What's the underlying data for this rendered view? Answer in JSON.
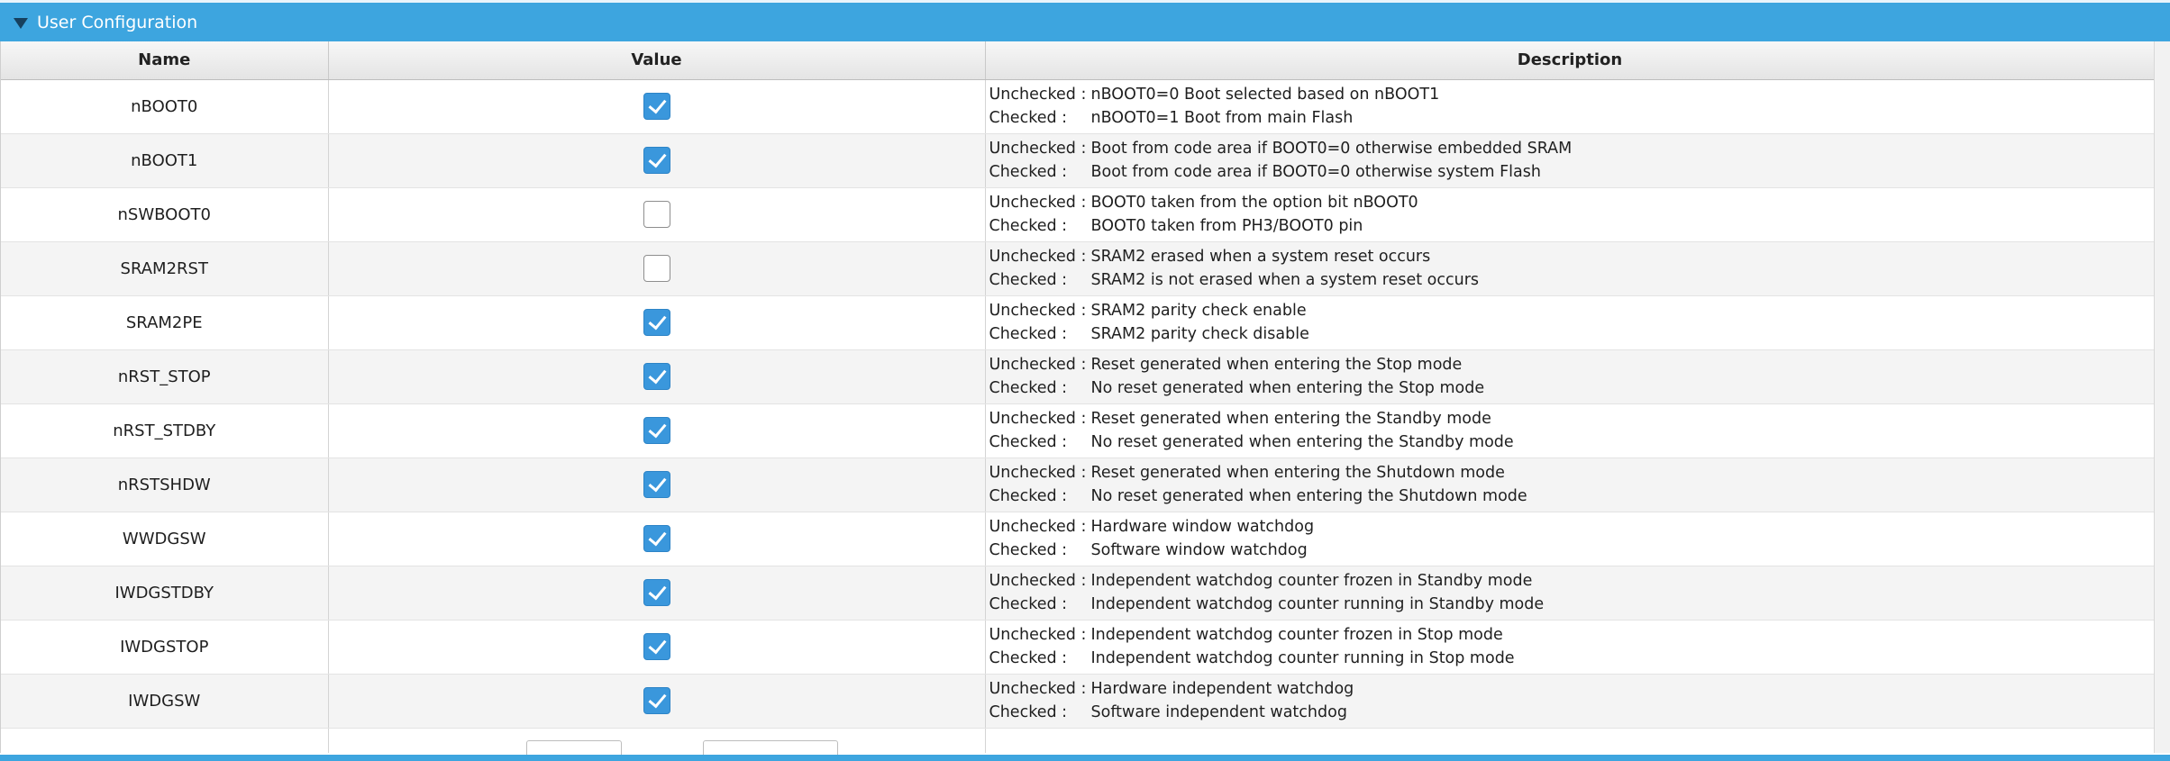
{
  "panel": {
    "title": "User Configuration"
  },
  "columns": {
    "name": "Name",
    "value": "Value",
    "description": "Description"
  },
  "rows": [
    {
      "name": "nBOOT0",
      "checked": true,
      "unchecked_label": "Unchecked",
      "unchecked_text": "nBOOT0=0 Boot selected based on nBOOT1",
      "checked_label": "Checked",
      "checked_text": "nBOOT0=1 Boot from main Flash"
    },
    {
      "name": "nBOOT1",
      "checked": true,
      "unchecked_label": "Unchecked",
      "unchecked_text": "Boot from code area if BOOT0=0 otherwise embedded SRAM",
      "checked_label": "Checked",
      "checked_text": "Boot from code area if BOOT0=0 otherwise system Flash"
    },
    {
      "name": "nSWBOOT0",
      "checked": false,
      "unchecked_label": "Unchecked",
      "unchecked_text": "BOOT0 taken from the option bit nBOOT0",
      "checked_label": "Checked",
      "checked_text": "BOOT0 taken from PH3/BOOT0 pin"
    },
    {
      "name": "SRAM2RST",
      "checked": false,
      "unchecked_label": "Unchecked",
      "unchecked_text": "SRAM2 erased when a system reset occurs",
      "checked_label": "Checked",
      "checked_text": "SRAM2 is not erased when a system reset occurs"
    },
    {
      "name": "SRAM2PE",
      "checked": true,
      "unchecked_label": "Unchecked",
      "unchecked_text": "SRAM2 parity check enable",
      "checked_label": "Checked",
      "checked_text": "SRAM2 parity check disable"
    },
    {
      "name": "nRST_STOP",
      "checked": true,
      "unchecked_label": "Unchecked",
      "unchecked_text": "Reset generated when entering the Stop mode",
      "checked_label": "Checked",
      "checked_text": "No reset generated when entering the Stop mode"
    },
    {
      "name": "nRST_STDBY",
      "checked": true,
      "unchecked_label": "Unchecked",
      "unchecked_text": "Reset generated when entering the Standby mode",
      "checked_label": "Checked",
      "checked_text": "No reset generated when entering the Standby mode"
    },
    {
      "name": "nRSTSHDW",
      "checked": true,
      "unchecked_label": "Unchecked",
      "unchecked_text": "Reset generated when entering the Shutdown mode",
      "checked_label": "Checked",
      "checked_text": "No reset generated when entering the Shutdown mode"
    },
    {
      "name": "WWDGSW",
      "checked": true,
      "unchecked_label": "Unchecked",
      "unchecked_text": "Hardware window watchdog",
      "checked_label": "Checked",
      "checked_text": "Software window watchdog"
    },
    {
      "name": "IWDGSTDBY",
      "checked": true,
      "unchecked_label": "Unchecked",
      "unchecked_text": "Independent watchdog counter frozen in Standby mode",
      "checked_label": "Checked",
      "checked_text": "Independent watchdog counter running in Standby mode"
    },
    {
      "name": "IWDGSTOP",
      "checked": true,
      "unchecked_label": "Unchecked",
      "unchecked_text": "Independent watchdog counter frozen in Stop mode",
      "checked_label": "Checked",
      "checked_text": "Independent watchdog counter running in Stop mode"
    },
    {
      "name": "IWDGSW",
      "checked": true,
      "unchecked_label": "Unchecked",
      "unchecked_text": "Hardware independent watchdog",
      "checked_label": "Checked",
      "checked_text": "Software independent watchdog"
    }
  ],
  "colors": {
    "header_bar": "#3da5df",
    "checkbox_checked": "#3a97dc",
    "collapse_icon": "#16405e"
  },
  "icons": {
    "collapse": "triangle-down-icon",
    "check": "checkmark-icon"
  }
}
